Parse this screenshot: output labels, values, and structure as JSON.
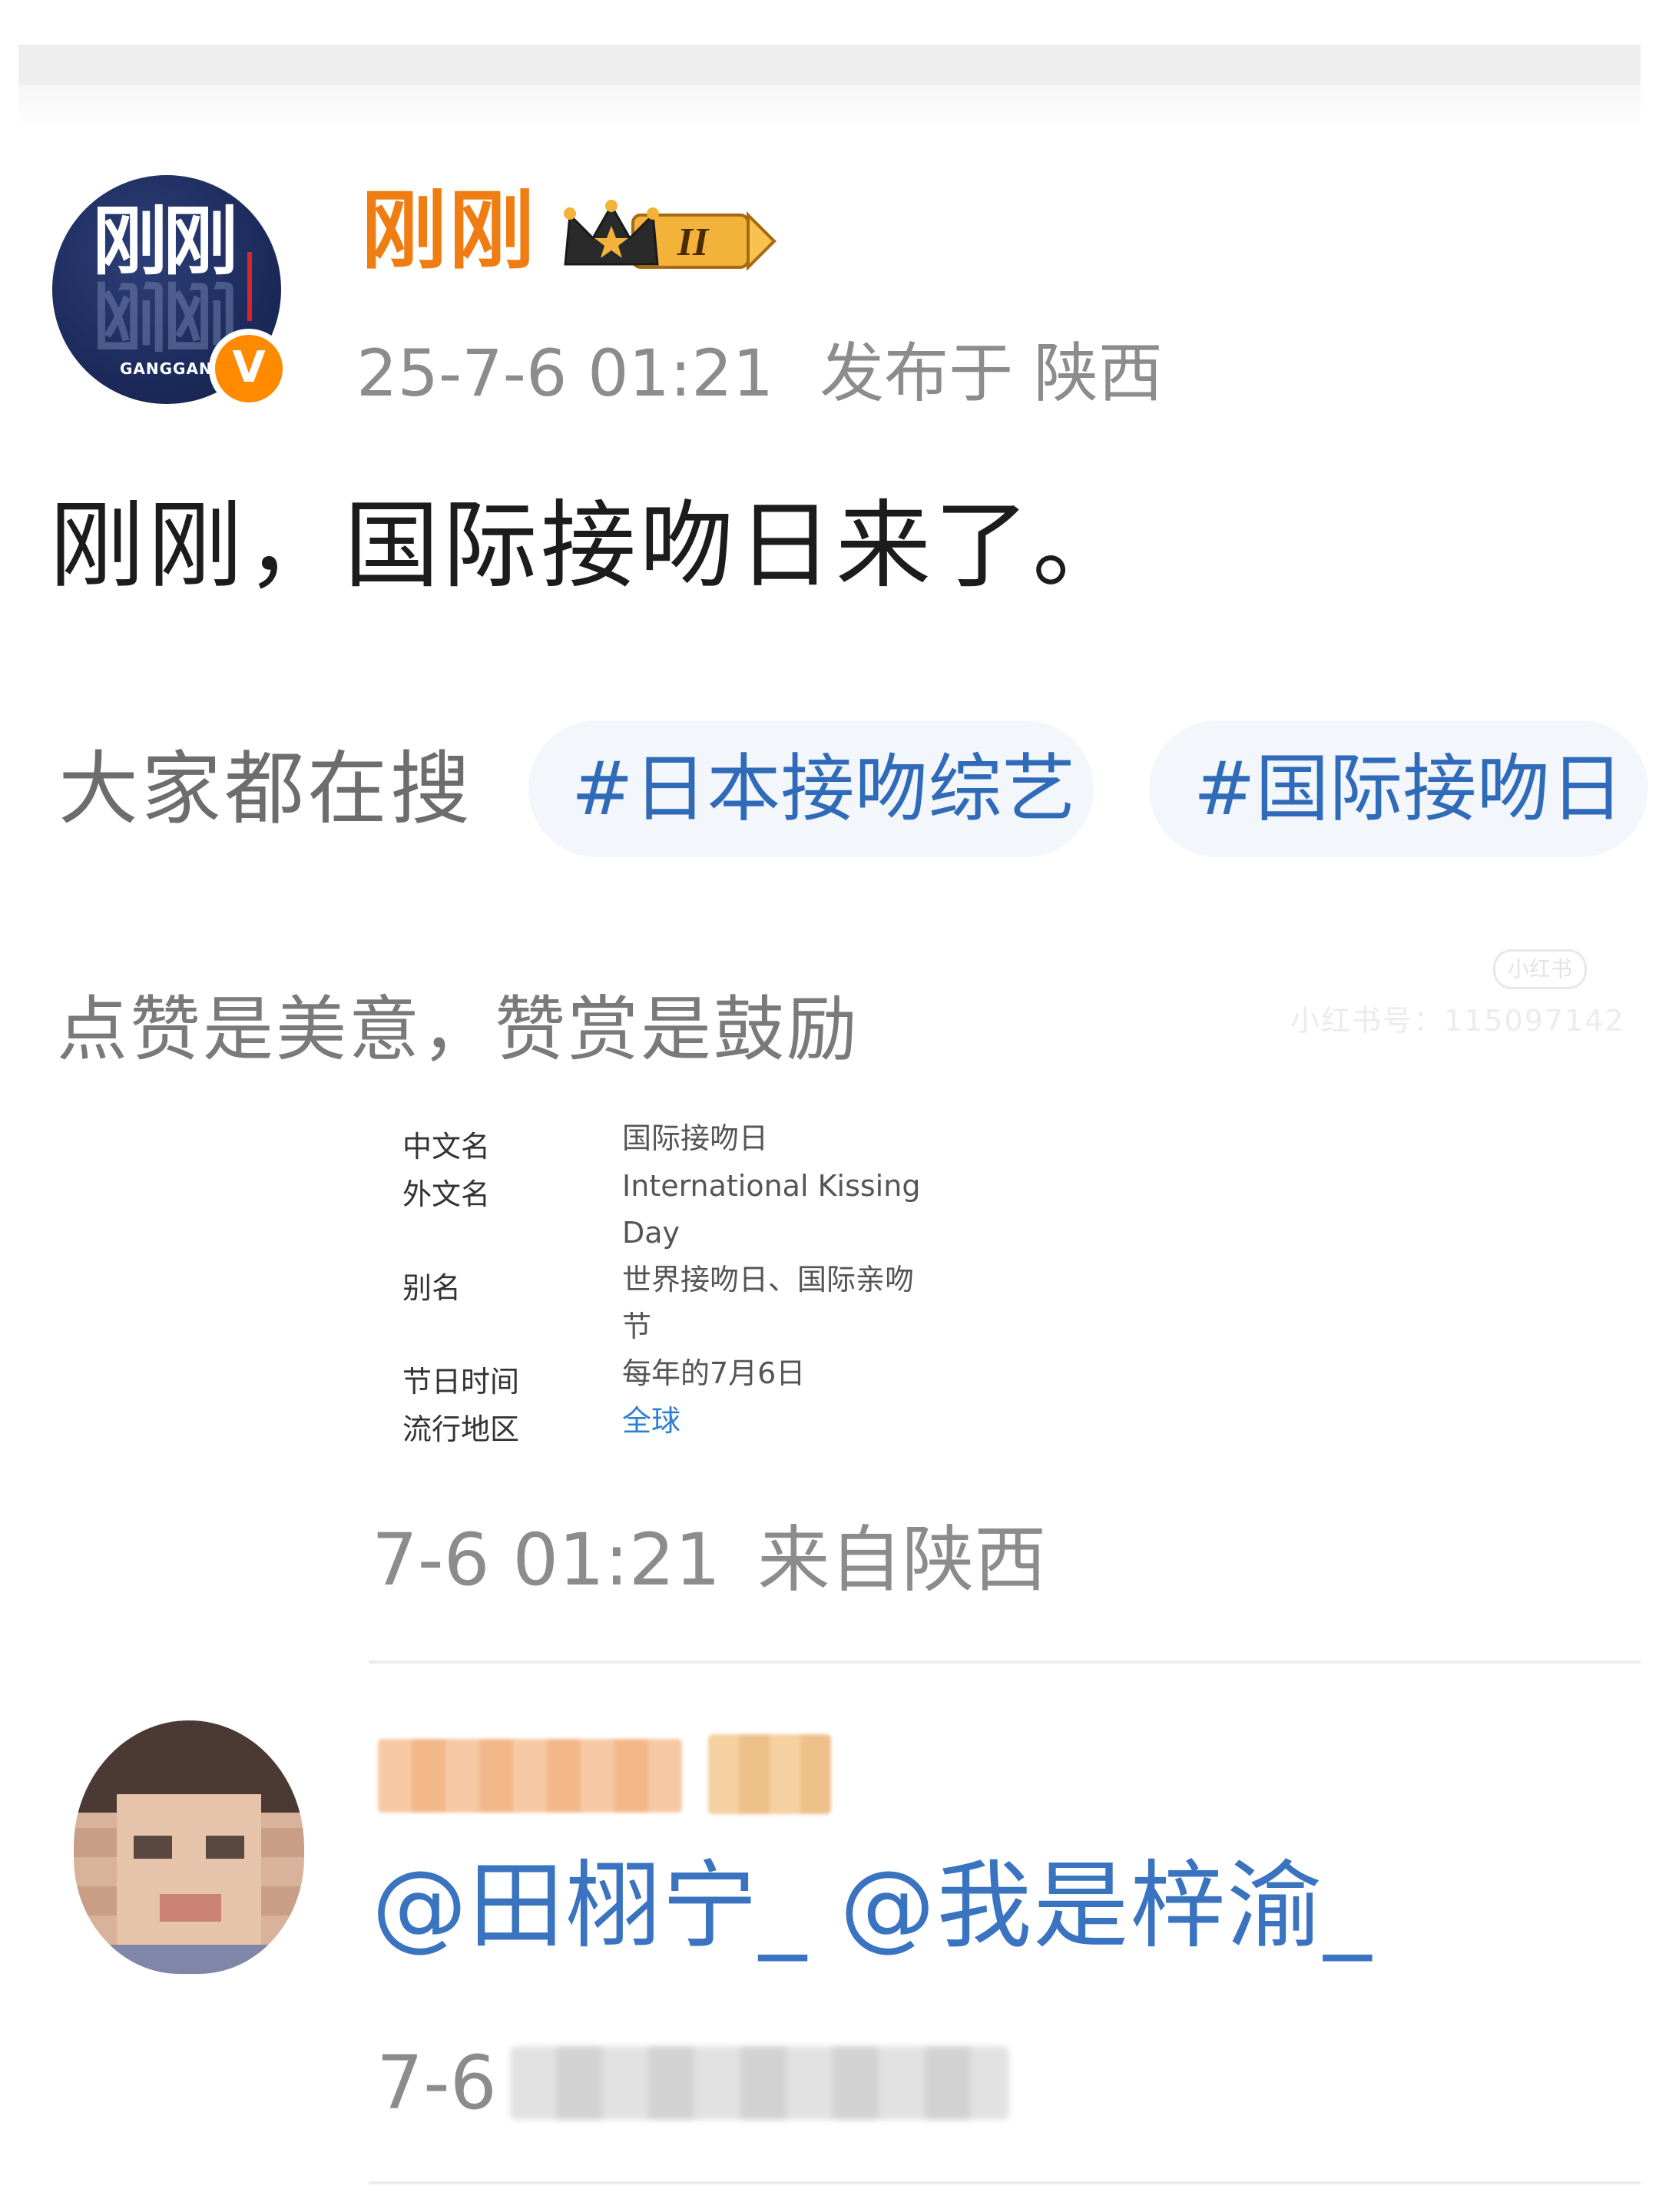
{
  "post": {
    "author": "刚刚",
    "level": "II",
    "avatar_logo": "刚刚",
    "avatar_logo_small": "GANGGAN",
    "verified_mark": "V",
    "timestamp": "25-7-6 01:21",
    "location": "发布于 陕西",
    "text": "刚刚，国际接吻日来了。",
    "search_label": "大家都在搜",
    "hashtags": [
      "#日本接吻综艺",
      "#国际接吻日"
    ],
    "reward_text": "点赞是美意，赞赏是鼓励",
    "watermark_logo": "小红书",
    "watermark_id": "小红书号：115097142"
  },
  "infobox": [
    {
      "key": "中文名",
      "value": "国际接吻日",
      "link": false
    },
    {
      "key": "外文名",
      "value": "International Kissing Day",
      "link": false
    },
    {
      "key": "别名",
      "value": "世界接吻日、国际亲吻节",
      "link": false
    },
    {
      "key": "节日时间",
      "value": "每年的7月6日",
      "link": false
    },
    {
      "key": "流行地区",
      "value": "全球",
      "link": true
    }
  ],
  "repost": {
    "time": "7-6 01:21",
    "source": "来自陕西"
  },
  "comment": {
    "text": "@田栩宁_ @我是梓渝_",
    "time_visible": "7-6"
  },
  "colors": {
    "author": "#f07d12",
    "link": "#2f6bb8",
    "meta": "#8c8c8c",
    "chip_bg": "#f3f6fb",
    "verified": "#ff8a00"
  }
}
